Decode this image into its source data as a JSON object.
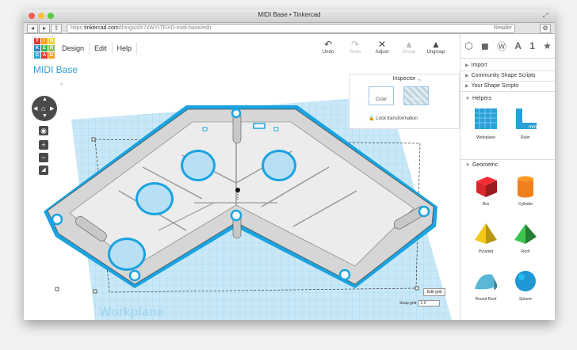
{
  "window": {
    "title": "MIDI Base • Tinkercad",
    "traffic_colors": [
      "#f25f58",
      "#fbbe3c",
      "#58cb42"
    ]
  },
  "addressbar": {
    "secure_label": "https",
    "domain": "tinkercad.com",
    "path": "/things/dX7xWYITRXD-midi-base/edit",
    "reader_label": "Reader"
  },
  "logo": {
    "letters": [
      "T",
      "I",
      "N",
      "K",
      "E",
      "R",
      "C",
      "A",
      "D"
    ],
    "colors": [
      "#e8382f",
      "#f7a11a",
      "#f3d31a",
      "#1e88c8",
      "#36b24a",
      "#8cc63f",
      "#2ea8d8",
      "#e8382f",
      "#f7a11a"
    ]
  },
  "menu": [
    "Design",
    "Edit",
    "Help"
  ],
  "toolbar": {
    "tools": [
      {
        "icon": "undo-icon",
        "label": "Undo",
        "glyph": "↶",
        "enabled": true
      },
      {
        "icon": "redo-icon",
        "label": "Redo",
        "glyph": "↷",
        "enabled": false
      },
      {
        "icon": "adjust-icon",
        "label": "Adjust",
        "glyph": "✕",
        "enabled": true
      },
      {
        "icon": "group-icon",
        "label": "Group",
        "glyph": "▲",
        "enabled": false
      },
      {
        "icon": "ungroup-icon",
        "label": "Ungroup",
        "glyph": "▲",
        "enabled": true
      }
    ]
  },
  "design": {
    "title": "MIDI Base",
    "help_mark": "?",
    "workplane_label": "Workplane",
    "workplane_color": "#bfe3f5",
    "grid_color": "#7cc6ea",
    "shape_color": "#d3d3d3",
    "outline_color": "#1aa3e0"
  },
  "inspector": {
    "title": "Inspector",
    "color_label": "Color",
    "hole_label": "Hole",
    "lock_label": "Lock transformation",
    "help_mark": "?"
  },
  "grid": {
    "edit_label": "Edit grid",
    "snap_label": "Snap grid",
    "snap_value": "1.0"
  },
  "sidebar": {
    "icons": [
      "cube-view-icon",
      "box-icon",
      "wordpress-icon",
      "letter-icon",
      "star-icon"
    ],
    "letter_glyph": "A",
    "number_glyph": "1",
    "sections": [
      "Import",
      "Community Shape Scripts",
      "Your Shape Scripts"
    ],
    "helpers_title": "Helpers",
    "helpers": [
      "Workplane",
      "Ruler"
    ],
    "geometric_title": "Geometric",
    "shapes": [
      {
        "label": "Box",
        "color": "#d8262c"
      },
      {
        "label": "Cylinder",
        "color": "#f07f1e"
      },
      {
        "label": "Pyramid",
        "color": "#f3c818"
      },
      {
        "label": "Roof",
        "color": "#37b34a"
      },
      {
        "label": "Round Roof",
        "color": "#5ab7d6"
      },
      {
        "label": "Sphere",
        "color": "#1f97d4"
      }
    ]
  }
}
